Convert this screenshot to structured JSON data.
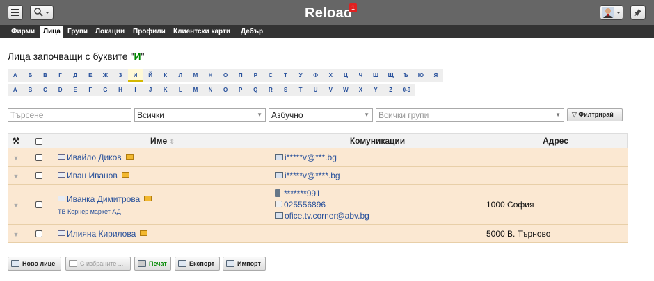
{
  "app": {
    "title": "Reload",
    "notification_count": "1"
  },
  "topbar": {
    "menu_icon": "menu-icon",
    "search_icon": "search-icon",
    "avatar_icon": "user-avatar-icon",
    "pin_icon": "pin-icon"
  },
  "nav": {
    "tabs": [
      {
        "label": "Фирми"
      },
      {
        "label": "Лица"
      },
      {
        "label": "Групи"
      },
      {
        "label": "Локации"
      },
      {
        "label": "Профили"
      },
      {
        "label": "Клиентски карти"
      },
      {
        "label": "Дебър"
      }
    ],
    "active_tab": "Лица"
  },
  "heading": {
    "prefix": "Лица започващи с буквите \"",
    "letter": "И",
    "suffix": "\""
  },
  "alphabet": {
    "cyrillic": [
      "А",
      "Б",
      "В",
      "Г",
      "Д",
      "Е",
      "Ж",
      "З",
      "И",
      "Й",
      "К",
      "Л",
      "М",
      "Н",
      "О",
      "П",
      "Р",
      "С",
      "Т",
      "У",
      "Ф",
      "Х",
      "Ц",
      "Ч",
      "Ш",
      "Щ",
      "Ъ",
      "Ю",
      "Я"
    ],
    "latin": [
      "A",
      "B",
      "C",
      "D",
      "E",
      "F",
      "G",
      "H",
      "I",
      "J",
      "K",
      "L",
      "M",
      "N",
      "O",
      "P",
      "Q",
      "R",
      "S",
      "T",
      "U",
      "V",
      "W",
      "X",
      "Y",
      "Z",
      "0-9"
    ],
    "selected": "И"
  },
  "filters": {
    "search_placeholder": "Търсене",
    "type_value": "Всички",
    "order_value": "Азбучно",
    "groups_placeholder": "Всички групи",
    "filter_button": "Филтрирай"
  },
  "table": {
    "headers": {
      "name": "Име",
      "communications": "Комуникации",
      "address": "Адрес"
    },
    "rows": [
      {
        "name": "Ивайло Диков",
        "company": "",
        "communications": [
          {
            "icon": "email-icon",
            "text": "i*****v@***.bg"
          }
        ],
        "address": ""
      },
      {
        "name": "Иван Иванов",
        "company": "",
        "communications": [
          {
            "icon": "email-icon",
            "text": "i*****v@****.bg"
          }
        ],
        "address": ""
      },
      {
        "name": "Иванка Димитрова",
        "company": "ТВ Корнер маркет АД",
        "communications": [
          {
            "icon": "mobile-phone-icon",
            "text": "*******991"
          },
          {
            "icon": "fax-icon",
            "text": "025556896"
          },
          {
            "icon": "email-icon",
            "text": "ofice.tv.corner@abv.bg"
          }
        ],
        "address": "1000 София"
      },
      {
        "name": "Илияна Кирилова",
        "company": "",
        "communications": [],
        "address": "5000 В. Търново"
      }
    ]
  },
  "actions": {
    "new_person": "Ново лице",
    "with_selected": "С избраните ...",
    "print": "Печат",
    "export": "Експорт",
    "import": "Импорт"
  }
}
